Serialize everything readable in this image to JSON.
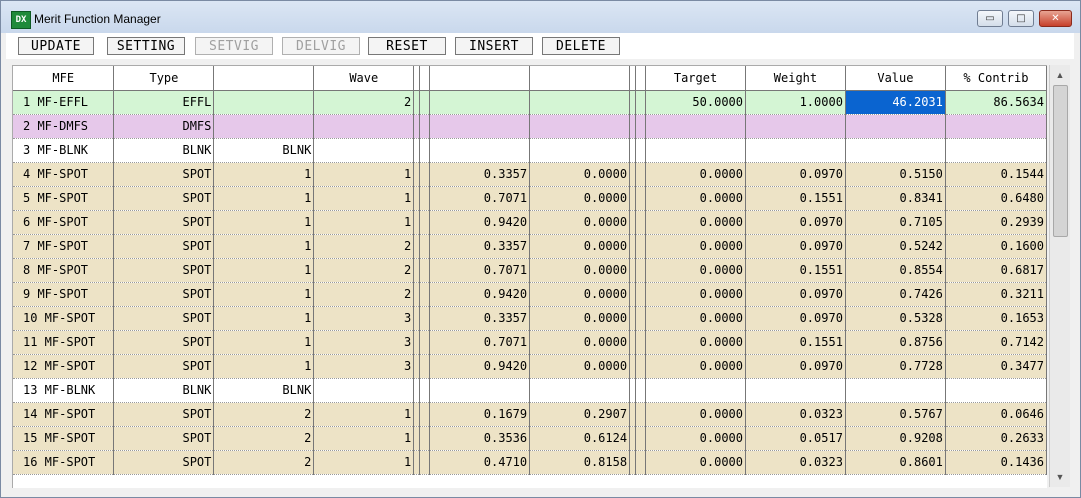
{
  "window": {
    "title": "Merit Function Manager",
    "icon_text": "DX"
  },
  "window_buttons": {
    "min": "▭",
    "max": "□",
    "close": "✕"
  },
  "toolbar": {
    "update": "UPDATE",
    "setting": "SETTING",
    "setvig": "SETVIG",
    "delvig": "DELVIG",
    "reset": "RESET",
    "insert": "INSERT",
    "delete": "DELETE"
  },
  "columns": [
    "MFE",
    "Type",
    "",
    "Wave",
    "",
    "",
    "Target",
    "Weight",
    "Value",
    "% Contrib"
  ],
  "rows": [
    {
      "kind": "sel",
      "c": [
        "1 MF-EFFL",
        "EFFL",
        "",
        "2",
        "",
        "",
        "50.0000",
        "1.0000",
        "46.2031",
        "86.5634"
      ]
    },
    {
      "kind": "dmfs",
      "c": [
        "2 MF-DMFS",
        "DMFS",
        "",
        "",
        "",
        "",
        "",
        "",
        "",
        ""
      ]
    },
    {
      "kind": "blnk",
      "c": [
        "3 MF-BLNK",
        "BLNK",
        "BLNK",
        "",
        "",
        "",
        "",
        "",
        "",
        ""
      ]
    },
    {
      "kind": "spot",
      "c": [
        "4 MF-SPOT",
        "SPOT",
        "1",
        "1",
        "0.3357",
        "0.0000",
        "0.0000",
        "0.0970",
        "0.5150",
        "0.1544"
      ]
    },
    {
      "kind": "spot",
      "c": [
        "5 MF-SPOT",
        "SPOT",
        "1",
        "1",
        "0.7071",
        "0.0000",
        "0.0000",
        "0.1551",
        "0.8341",
        "0.6480"
      ]
    },
    {
      "kind": "spot",
      "c": [
        "6 MF-SPOT",
        "SPOT",
        "1",
        "1",
        "0.9420",
        "0.0000",
        "0.0000",
        "0.0970",
        "0.7105",
        "0.2939"
      ]
    },
    {
      "kind": "spot",
      "c": [
        "7 MF-SPOT",
        "SPOT",
        "1",
        "2",
        "0.3357",
        "0.0000",
        "0.0000",
        "0.0970",
        "0.5242",
        "0.1600"
      ]
    },
    {
      "kind": "spot",
      "c": [
        "8 MF-SPOT",
        "SPOT",
        "1",
        "2",
        "0.7071",
        "0.0000",
        "0.0000",
        "0.1551",
        "0.8554",
        "0.6817"
      ]
    },
    {
      "kind": "spot",
      "c": [
        "9 MF-SPOT",
        "SPOT",
        "1",
        "2",
        "0.9420",
        "0.0000",
        "0.0000",
        "0.0970",
        "0.7426",
        "0.3211"
      ]
    },
    {
      "kind": "spot",
      "c": [
        "10 MF-SPOT",
        "SPOT",
        "1",
        "3",
        "0.3357",
        "0.0000",
        "0.0000",
        "0.0970",
        "0.5328",
        "0.1653"
      ]
    },
    {
      "kind": "spot",
      "c": [
        "11 MF-SPOT",
        "SPOT",
        "1",
        "3",
        "0.7071",
        "0.0000",
        "0.0000",
        "0.1551",
        "0.8756",
        "0.7142"
      ]
    },
    {
      "kind": "spot",
      "c": [
        "12 MF-SPOT",
        "SPOT",
        "1",
        "3",
        "0.9420",
        "0.0000",
        "0.0000",
        "0.0970",
        "0.7728",
        "0.3477"
      ]
    },
    {
      "kind": "blnk",
      "c": [
        "13 MF-BLNK",
        "BLNK",
        "BLNK",
        "",
        "",
        "",
        "",
        "",
        "",
        ""
      ]
    },
    {
      "kind": "spot",
      "c": [
        "14 MF-SPOT",
        "SPOT",
        "2",
        "1",
        "0.1679",
        "0.2907",
        "0.0000",
        "0.0323",
        "0.5767",
        "0.0646"
      ]
    },
    {
      "kind": "spot",
      "c": [
        "15 MF-SPOT",
        "SPOT",
        "2",
        "1",
        "0.3536",
        "0.6124",
        "0.0000",
        "0.0517",
        "0.9208",
        "0.2633"
      ]
    },
    {
      "kind": "spot",
      "c": [
        "16 MF-SPOT",
        "SPOT",
        "2",
        "1",
        "0.4710",
        "0.8158",
        "0.0000",
        "0.0323",
        "0.8601",
        "0.1436"
      ]
    }
  ],
  "colors": {
    "selected_row": "#d4f5d4",
    "dmfs_row": "#e6c8ea",
    "spot_row": "#ede3c6",
    "highlight_cell": "#0a64d0"
  },
  "selected_cell": {
    "row": 0,
    "col": 8
  }
}
